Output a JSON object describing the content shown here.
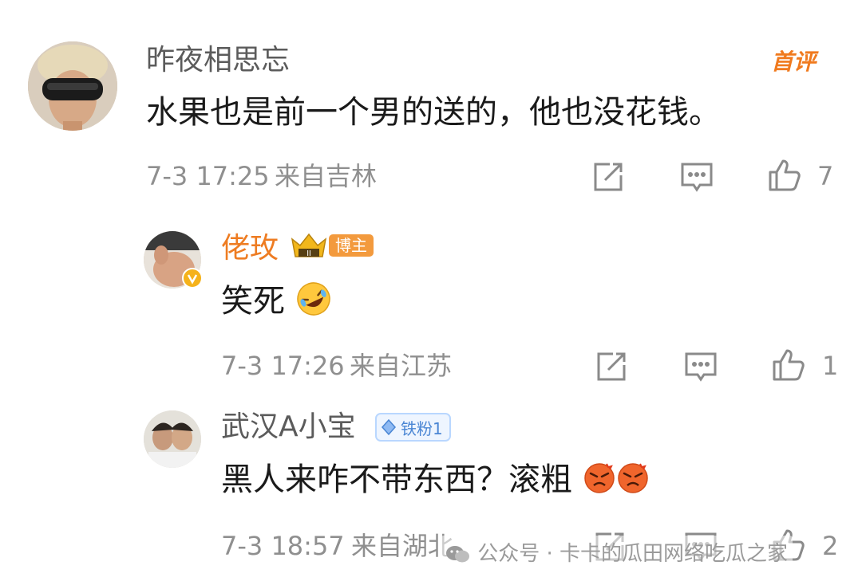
{
  "comments": [
    {
      "username": "昨夜相思忘",
      "text": "水果也是前一个男的送的，他也没花钱。",
      "time": "7-3 17:25",
      "location": "来自吉林",
      "likes": "7",
      "tag": "首评"
    },
    {
      "username": "佬玫",
      "text": "笑死",
      "time": "7-3 17:26",
      "location": "来自江苏",
      "likes": "1",
      "badge": "博主",
      "crown_level": "II"
    },
    {
      "username": "武汉A小宝",
      "text": "黑人来咋不带东西？滚粗",
      "time": "7-3 18:57",
      "location": "来自湖北",
      "likes": "2",
      "badge": "铁粉1"
    }
  ],
  "watermark": "公众号 · 卡卡的瓜田网络吃瓜之家",
  "colors": {
    "blogger_name": "#ee7c22",
    "name": "#5b5b5b",
    "meta": "#8f8f8f",
    "fan_badge": "#4a86d4",
    "first_comment_tag": "#f07a1e"
  }
}
